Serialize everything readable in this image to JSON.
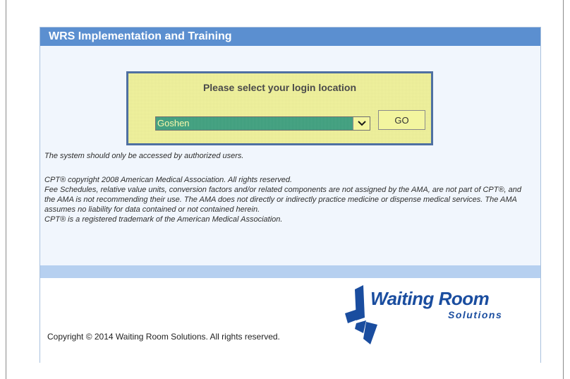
{
  "panel": {
    "title": "WRS Implementation and Training"
  },
  "login": {
    "prompt": "Please select your login location",
    "selected_location": "Goshen",
    "go_label": "GO"
  },
  "notices": {
    "authorized": "The system should only be accessed by authorized users.",
    "legal": [
      "CPT® copyright 2008 American Medical Association. All rights reserved.",
      "Fee Schedules, relative value units, conversion factors and/or related components are not assigned by the AMA, are not part of CPT®, and the AMA is not recommending their use. The AMA does not directly or indirectly practice medicine or dispense medical services. The AMA assumes no liability for data contained or not contained herein.",
      "CPT® is a registered trademark of the American Medical Association."
    ]
  },
  "footer": {
    "copyright": "Copyright © 2014 Waiting Room Solutions. All rights reserved.",
    "logo_name": "Waiting Room",
    "logo_sub": "Solutions"
  },
  "colors": {
    "header": "#5b8fd0",
    "login_box": "#f3f59f",
    "select_highlight": "#3d9d7c",
    "brand": "#1a4d9f"
  },
  "icons": {
    "dropdown": "chevron-down-icon",
    "logo": "waiting-room-solutions-logo"
  }
}
